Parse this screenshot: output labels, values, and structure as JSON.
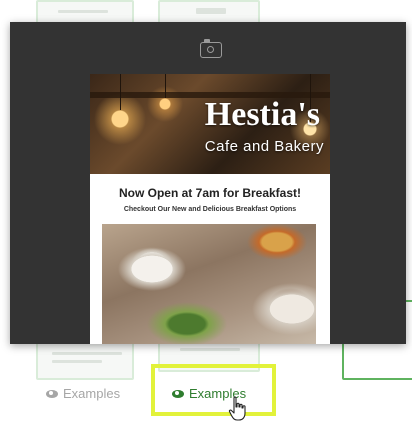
{
  "preview": {
    "brand_title": "Hestia's",
    "brand_subtitle": "Cafe and Bakery",
    "headline": "Now Open at 7am for Breakfast!",
    "subheadline": "Checkout Our New and Delicious Breakfast Options",
    "camera_icon": "camera-icon"
  },
  "cards": [
    {
      "examples_label": "Examples",
      "state": "default"
    },
    {
      "examples_label": "Examples",
      "state": "highlighted"
    }
  ],
  "colors": {
    "overlay": "#333333",
    "highlight": "#e2f23a",
    "active_green": "#2f7d2f",
    "muted_gray": "#a6a6a6",
    "card_border_green": "#5fb35f"
  }
}
